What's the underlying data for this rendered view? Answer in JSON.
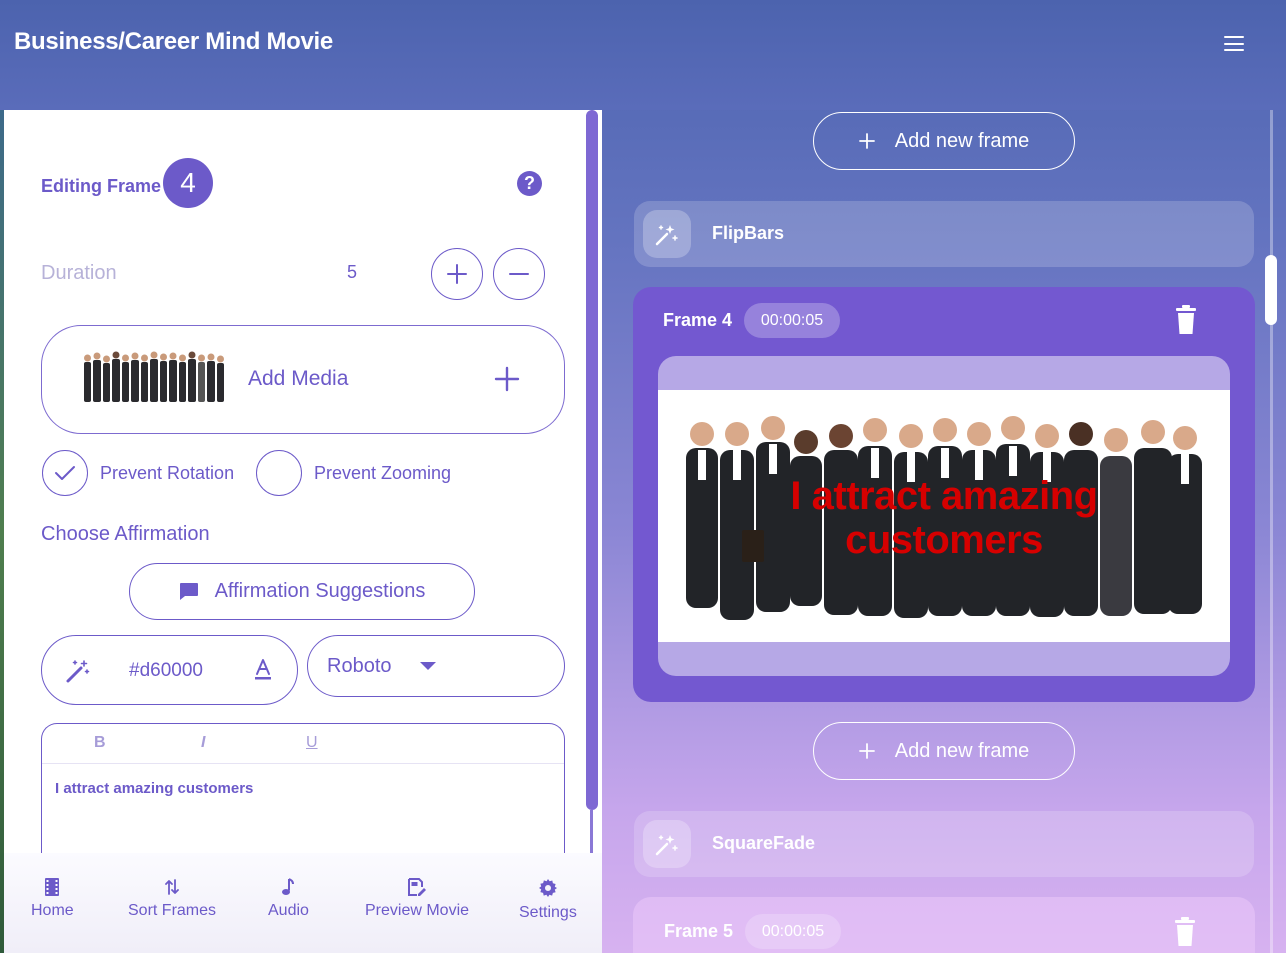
{
  "app": {
    "title": "Business/Career Mind Movie"
  },
  "editor": {
    "editing_label": "Editing Frame",
    "frame_number": "4",
    "help": "?",
    "duration_label": "Duration",
    "duration_value": "5",
    "increment": "+",
    "decrement": "−",
    "add_media_label": "Add Media",
    "add_media_plus": "+",
    "prevent_rotation": {
      "label": "Prevent Rotation",
      "checked": true
    },
    "prevent_zooming": {
      "label": "Prevent Zooming",
      "checked": false
    },
    "choose_affirmation": "Choose Affirmation",
    "affirmation_suggestions": "Affirmation Suggestions",
    "text_color": "#d60000",
    "font": "Roboto",
    "toolbar": {
      "bold": "B",
      "italic": "I",
      "underline": "U"
    },
    "affirmation_text": "I attract amazing customers"
  },
  "bottom_nav": [
    {
      "label": "Home",
      "icon": "film-icon"
    },
    {
      "label": "Sort Frames",
      "icon": "sort-icon"
    },
    {
      "label": "Audio",
      "icon": "music-note-icon"
    },
    {
      "label": "Preview Movie",
      "icon": "preview-icon"
    },
    {
      "label": "Settings",
      "icon": "gear-icon"
    }
  ],
  "timeline": {
    "add_frame_label": "Add new frame",
    "add_frame_plus": "+",
    "transition_1": "FlipBars",
    "transition_2": "SquareFade",
    "frame_4": {
      "title": "Frame 4",
      "time": "00:00:05",
      "caption": "I attract amazing customers"
    },
    "frame_5": {
      "title": "Frame 5",
      "time": "00:00:05"
    }
  },
  "colors": {
    "accent": "#6c5ac9",
    "caption": "#d60000",
    "card": "#7358d0"
  }
}
